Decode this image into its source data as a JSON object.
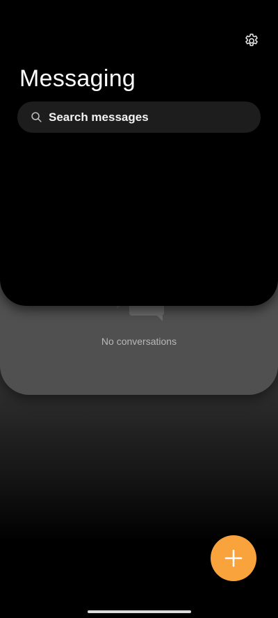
{
  "header": {
    "title": "Messaging",
    "settings_icon": "gear-icon"
  },
  "search": {
    "placeholder": "Search messages",
    "icon": "search-icon"
  },
  "empty_state": {
    "icon": "chat-bubbles-icon",
    "message": "No conversations"
  },
  "fab": {
    "icon": "plus-icon",
    "color": "#F9A33C"
  },
  "colors": {
    "background": "#000000",
    "card": "#505050",
    "search_bg": "#1D1D1D",
    "accent": "#F9A33C"
  }
}
